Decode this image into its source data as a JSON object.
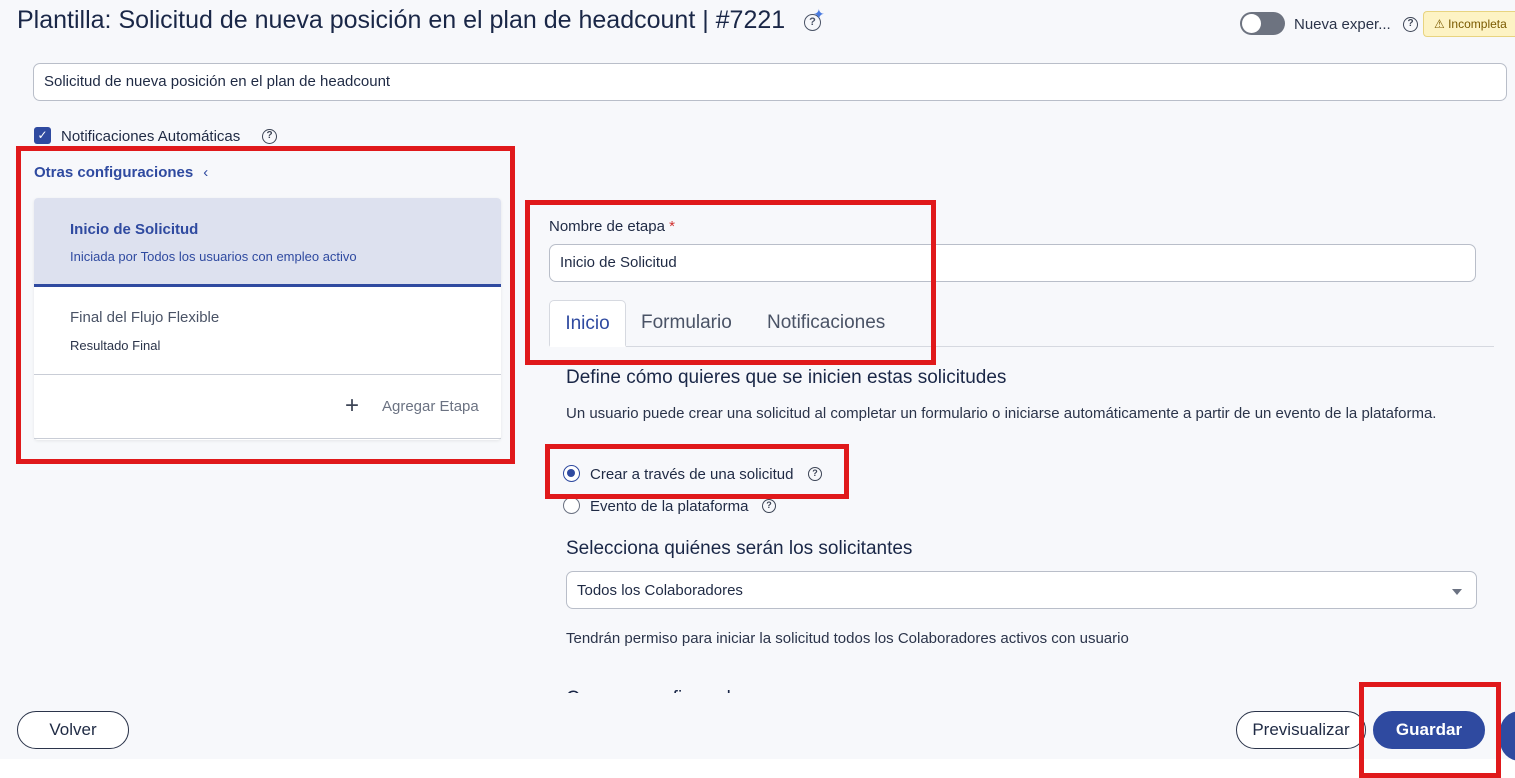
{
  "header": {
    "title": "Plantilla: Solicitud de nueva posición en el plan de headcount | #7221",
    "help_glyph": "?",
    "sparkle_glyph": "✦",
    "toggle_label": "Nueva exper...",
    "status_badge": "⚠ Incompleta"
  },
  "template_name": {
    "value": "Solicitud de nueva posición en el plan de headcount"
  },
  "auto_notifications": {
    "label": "Notificaciones Automáticas",
    "checked": true,
    "check_glyph": "✓"
  },
  "left_panel": {
    "title": "Otras configuraciones",
    "collapse_glyph": "‹",
    "stages": [
      {
        "title": "Inicio de Solicitud",
        "subtitle": "Iniciada por Todos los usuarios con empleo activo",
        "active": true
      },
      {
        "title": "Final del Flujo Flexible",
        "subtitle": "Resultado Final",
        "active": false
      }
    ],
    "add_stage_glyph": "+",
    "add_stage_label": "Agregar Etapa"
  },
  "stage_form": {
    "name_label": "Nombre de etapa",
    "required_mark": "*",
    "name_value": "Inicio de Solicitud",
    "tabs": [
      {
        "label": "Inicio",
        "active": true
      },
      {
        "label": "Formulario",
        "active": false
      },
      {
        "label": "Notificaciones",
        "active": false
      }
    ]
  },
  "start_section": {
    "title": "Define cómo quieres que se inicien estas solicitudes",
    "description": "Un usuario puede crear una solicitud al completar un formulario o iniciarse automáticamente a partir de un evento de la plataforma.",
    "options": [
      {
        "label": "Crear a través de una solicitud",
        "selected": true
      },
      {
        "label": "Evento de la plataforma",
        "selected": false
      }
    ]
  },
  "requesters_section": {
    "title": "Selecciona quiénes serán los solicitantes",
    "selected_value": "Todos los Colaboradores",
    "note": "Tendrán permiso para iniciar la solicitud todos los Colaboradores activos con usuario",
    "next_title_cut": "Campos configurados"
  },
  "footer": {
    "back_label": "Volver",
    "preview_label": "Previsualizar",
    "save_label": "Guardar"
  },
  "colors": {
    "primary": "#2f4aa0",
    "annotation_red": "#e0191b",
    "badge_bg": "#fdf3c4"
  }
}
